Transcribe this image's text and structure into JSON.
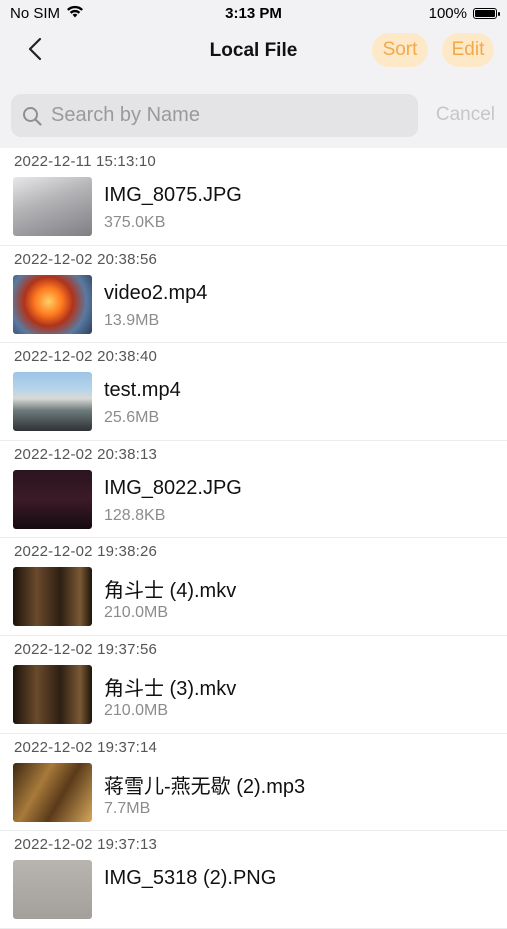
{
  "status": {
    "carrier": "No SIM",
    "time": "3:13 PM",
    "battery": "100%"
  },
  "nav": {
    "title": "Local File",
    "sort_label": "Sort",
    "edit_label": "Edit"
  },
  "search": {
    "placeholder": "Search by Name",
    "value": "",
    "cancel_label": "Cancel"
  },
  "files": [
    {
      "date": "2022-12-11 15:13:10",
      "name": "IMG_8075.JPG",
      "size": "375.0KB"
    },
    {
      "date": "2022-12-02 20:38:56",
      "name": "video2.mp4",
      "size": "13.9MB"
    },
    {
      "date": "2022-12-02 20:38:40",
      "name": "test.mp4",
      "size": "25.6MB"
    },
    {
      "date": "2022-12-02 20:38:13",
      "name": "IMG_8022.JPG",
      "size": "128.8KB"
    },
    {
      "date": "2022-12-02 19:38:26",
      "name": "角斗士 (4).mkv",
      "size": "210.0MB"
    },
    {
      "date": "2022-12-02 19:37:56",
      "name": "角斗士 (3).mkv",
      "size": "210.0MB"
    },
    {
      "date": "2022-12-02 19:37:14",
      "name": "蒋雪儿-燕无歇 (2).mp3",
      "size": "7.7MB"
    },
    {
      "date": "2022-12-02 19:37:13",
      "name": "IMG_5318 (2).PNG",
      "size": ""
    }
  ],
  "colors": {
    "accent": "#f2a94a",
    "accent_bg": "#fde9c8",
    "header_bg": "#f2f2f4",
    "search_bg": "#e4e4e6"
  }
}
